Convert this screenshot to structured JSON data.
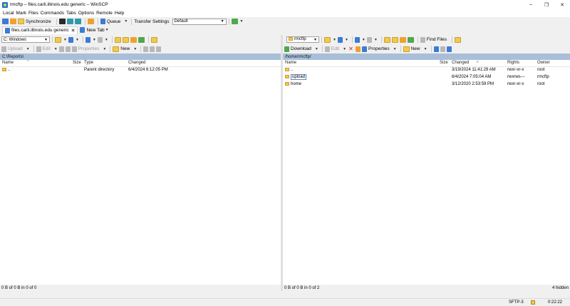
{
  "window": {
    "title": "rmcftp – files.carli.illinois.edu generic – WinSCP",
    "controls": [
      "–",
      "❐",
      "✕"
    ]
  },
  "menu": [
    "Local",
    "Mark",
    "Files",
    "Commands",
    "Tabs",
    "Options",
    "Remote",
    "Help"
  ],
  "toolbar": {
    "synchronize": "Synchronize",
    "queue": "Queue",
    "transfer_settings": "Transfer Settings",
    "transfer_preset": "Default"
  },
  "tabs": {
    "session": "files.carli.illinois.edu generic",
    "new_tab": "New Tab"
  },
  "left": {
    "drive": "C: Windows",
    "upload": "Upload",
    "edit": "Edit",
    "properties": "Properties",
    "new": "New",
    "path": "C:\\Reports\\",
    "columns": [
      "Name",
      "Size",
      "Type",
      "Changed"
    ],
    "rows": [
      {
        "name": "..",
        "size": "",
        "type": "Parent directory",
        "changed": "6/4/2024 6:12:05 PM"
      }
    ],
    "status": "0 B of 0 B in 0 of 0"
  },
  "right": {
    "location": "rmcftp",
    "find_files": "Find Files",
    "download": "Download",
    "edit": "Edit",
    "properties": "Properties",
    "new": "New",
    "path": "/home/rmcftp/",
    "columns": [
      "Name",
      "Size",
      "Changed",
      "Rights",
      "Owner"
    ],
    "rows": [
      {
        "name": "..",
        "size": "",
        "changed": "3/19/2024 11:41:29 AM",
        "rights": "rwxr-xr-x",
        "owner": "root"
      },
      {
        "name": "upload",
        "size": "",
        "changed": "6/4/2024 7:05:04 AM",
        "rights": "rwxrws---",
        "owner": "rmcftp"
      },
      {
        "name": "home",
        "size": "",
        "changed": "3/12/2020 2:53:59 PM",
        "rights": "rwxr-xr-x",
        "owner": "root"
      }
    ],
    "status": "0 B of 0 B in 0 of 2",
    "hidden": "4 hidden"
  },
  "statusbar": {
    "protocol": "SFTP-3",
    "elapsed": "0:22:22"
  },
  "colors": {
    "path_bar": "#a9bfd9",
    "folder": "#f2c94c",
    "delete": "#d02020"
  }
}
